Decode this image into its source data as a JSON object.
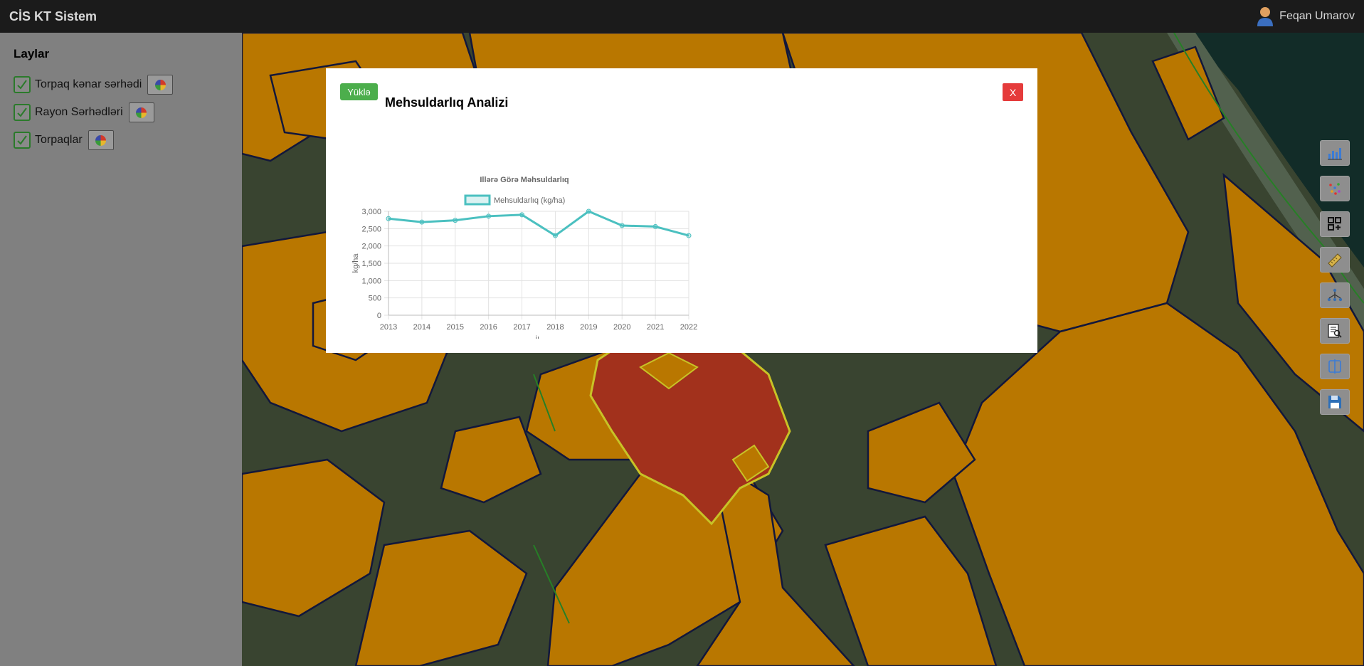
{
  "app": {
    "title": "CİS KT Sistem"
  },
  "user": {
    "name": "Feqan Umarov"
  },
  "sidebar": {
    "title": "Laylar",
    "layers": [
      {
        "label": "Torpaq kənar sərhədi",
        "checked": true
      },
      {
        "label": "Rayon Sərhədləri",
        "checked": true
      },
      {
        "label": "Torpaqlar",
        "checked": true
      }
    ]
  },
  "toolbar": {
    "tools": [
      "bar-chart-icon",
      "scatter-icon",
      "grid-add-icon",
      "ruler-icon",
      "tree-icon",
      "report-search-icon",
      "split-view-icon",
      "save-icon"
    ]
  },
  "modal": {
    "download_label": "Yüklə",
    "close_label": "X",
    "title": "Mehsuldarlıq Analizi"
  },
  "colors": {
    "parcel": "#c98200",
    "selected": "#b0361f",
    "outline": "#141940",
    "highlight": "#d9d42a",
    "line": "#4bc0c0"
  },
  "chart_data": {
    "type": "line",
    "title": "Illərə Görə Məhsuldarlıq",
    "xlabel": "İl",
    "ylabel": "kg/ha",
    "x": [
      "2013",
      "2014",
      "2015",
      "2016",
      "2017",
      "2018",
      "2019",
      "2020",
      "2021",
      "2022"
    ],
    "series": [
      {
        "name": "Mehsuldarlıq (kg/ha)",
        "values": [
          2790,
          2690,
          2740,
          2860,
          2900,
          2300,
          3000,
          2590,
          2560,
          2300
        ]
      }
    ],
    "ylim": [
      0,
      3000
    ],
    "yticks": [
      "0",
      "500",
      "1,000",
      "1,500",
      "2,000",
      "2,500",
      "3,000"
    ],
    "legend": "top",
    "grid": true
  }
}
